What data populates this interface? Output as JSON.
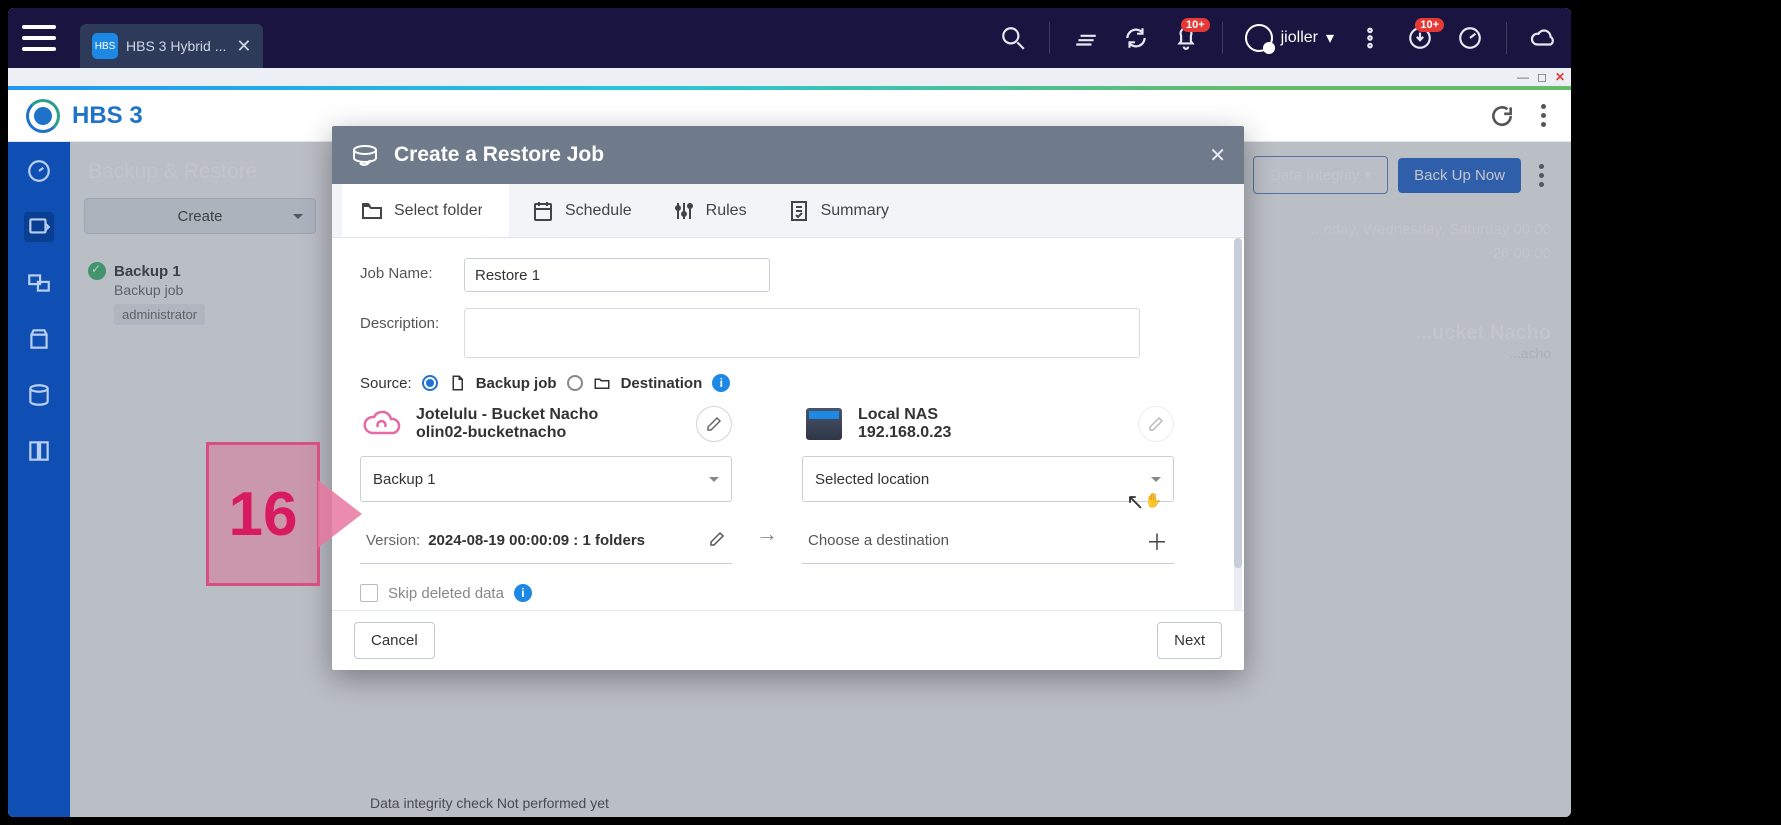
{
  "os": {
    "tab_title": "HBS 3 Hybrid ...",
    "username": "jioller",
    "badge1": "10+",
    "badge2": "10+"
  },
  "app": {
    "name": "HBS 3",
    "page_title": "Backup & Restore",
    "create_label": "Create"
  },
  "job": {
    "name": "Backup 1",
    "type": "Backup job",
    "owner": "administrator"
  },
  "rightinfo": {
    "schedule_line1": "...nday, Wednesday, Saturday 00:00",
    "schedule_line2": "-26 00:00",
    "bucket_title": "...ucket Nacho",
    "bucket_sub": "...acho"
  },
  "topbuttons": {
    "integrity": "Data Integrity",
    "backup": "Back Up Now"
  },
  "modal": {
    "title": "Create a Restore Job",
    "steps": {
      "select": "Select folders",
      "schedule": "Schedule",
      "rules": "Rules",
      "summary": "Summary"
    },
    "jobname_label": "Job Name:",
    "jobname_value": "Restore 1",
    "desc_label": "Description:",
    "source_label": "Source:",
    "backupjob_label": "Backup job",
    "destination_label": "Destination",
    "src": {
      "line1": "Jotelulu - Bucket Nacho",
      "line2": "olin02-bucketnacho"
    },
    "dst": {
      "line1": "Local NAS",
      "line2": "192.168.0.23"
    },
    "select_backup": "Backup 1",
    "select_location": "Selected location",
    "version_label": "Version:",
    "version_value": "2024-08-19 00:00:09 : 1 folders",
    "choose_dest": "Choose a destination",
    "skip_label": "Skip deleted data",
    "cancel": "Cancel",
    "next": "Next"
  },
  "callout": {
    "num": "16"
  },
  "bottom_obscured": "Data integrity check   Not performed yet"
}
